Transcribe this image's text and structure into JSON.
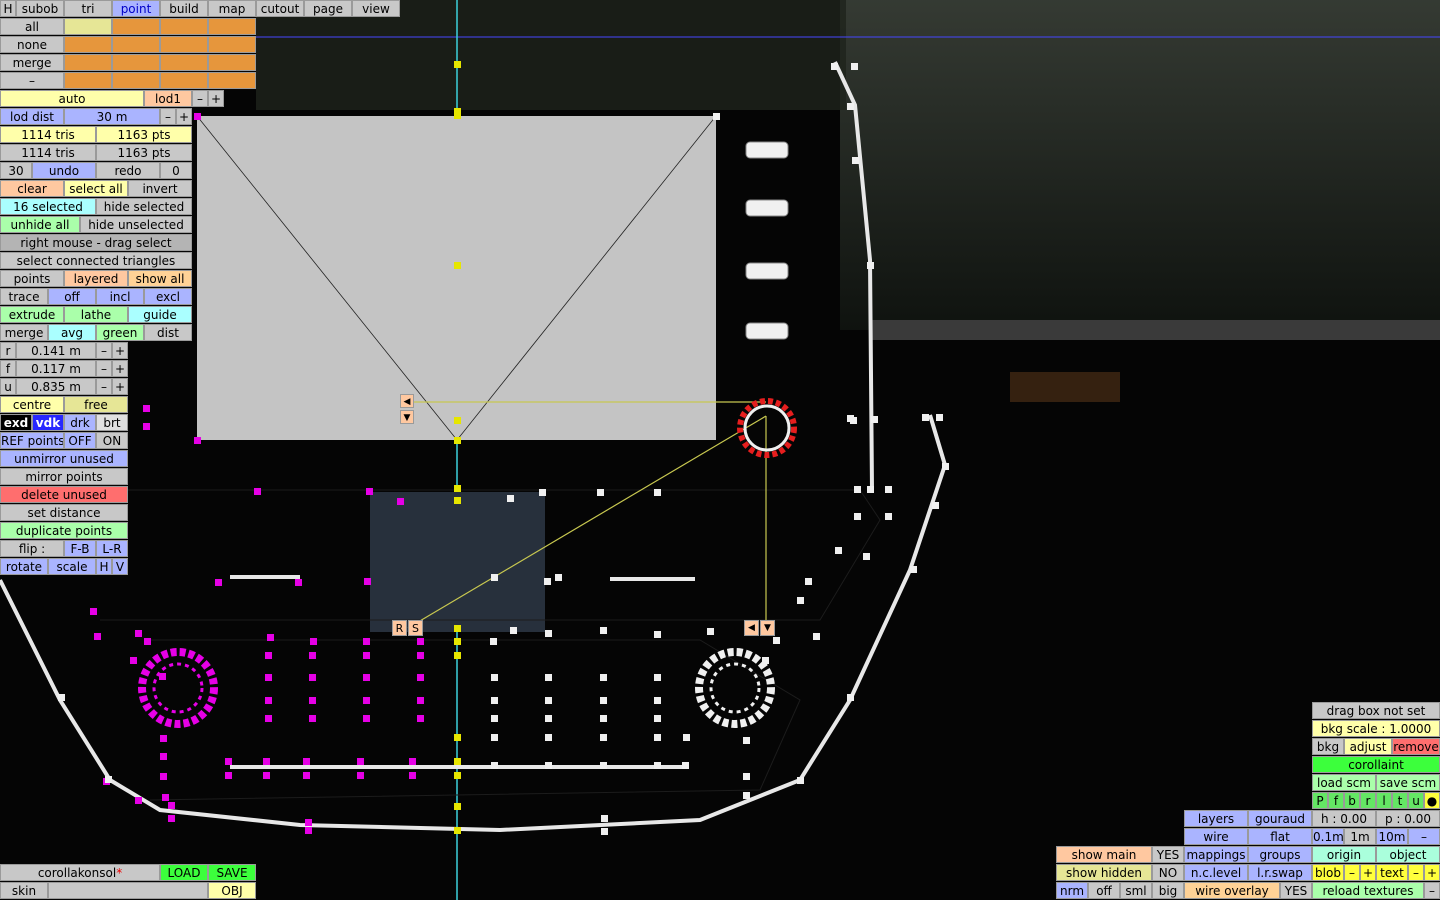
{
  "menu": [
    "H",
    "subob",
    "tri",
    "point",
    "build",
    "map",
    "cutout",
    "page",
    "view"
  ],
  "active_menu": "point",
  "sel_rows": [
    "all",
    "none",
    "merge",
    "–"
  ],
  "lod": {
    "mode": "auto",
    "level": "lod1",
    "minus": "–",
    "plus": "+",
    "dist_label": "lod dist",
    "dist_value": "30 m"
  },
  "stats": {
    "tris1": "1114 tris",
    "pts1": "1163 pts",
    "tris2": "1114 tris",
    "pts2": "1163 pts"
  },
  "history": {
    "count": "30",
    "undo": "undo",
    "redo": "redo",
    "redo_count": "0"
  },
  "select": {
    "clear": "clear",
    "select_all": "select all",
    "invert": "invert",
    "selected": "16 selected",
    "hide_selected": "hide selected",
    "unhide_all": "unhide all",
    "hide_unselected": "hide unselected",
    "drag_hint": "right mouse - drag select",
    "connected": "select connected triangles"
  },
  "mode": {
    "points": "points",
    "layered": "layered",
    "show_all": "show all",
    "trace": "trace",
    "off": "off",
    "incl": "incl",
    "excl": "excl",
    "extrude": "extrude",
    "lathe": "lathe",
    "guide": "guide",
    "merge": "merge",
    "avg": "avg",
    "green": "green",
    "dist": "dist"
  },
  "coords": [
    {
      "axis": "r",
      "value": "0.141 m"
    },
    {
      "axis": "f",
      "value": "0.117 m"
    },
    {
      "axis": "u",
      "value": "0.835 m"
    }
  ],
  "pivot": {
    "centre": "centre",
    "free": "free"
  },
  "view_mode": {
    "exd": "exd",
    "vdk": "vdk",
    "drk": "drk",
    "brt": "brt",
    "ref": "REF points",
    "off": "OFF",
    "on": "ON"
  },
  "actions": {
    "unmirror": "unmirror unused",
    "mirror": "mirror points",
    "delete": "delete unused",
    "set_distance": "set distance",
    "duplicate": "duplicate points",
    "flip": "flip :",
    "fb": "F-B",
    "lr": "L-R",
    "rotate": "rotate",
    "scale": "scale",
    "h": "H",
    "v": "V"
  },
  "file": {
    "name": "corollakonsol",
    "modified_mark": "*",
    "load": "LOAD",
    "save": "SAVE",
    "skin": "skin",
    "obj": "OBJ"
  },
  "markers": {
    "left_arrow": "◀",
    "down_arrow": "▼",
    "r": "R",
    "s": "S"
  },
  "right_panel": {
    "drag_box": "drag box not set",
    "bkg_scale": "bkg scale : 1.0000",
    "bkg": "bkg",
    "adjust": "adjust",
    "remove": "remove",
    "project": "corollaint",
    "load_scm": "load scm",
    "save_scm": "save scm",
    "letters": [
      "P",
      "f",
      "b",
      "r",
      "l",
      "t",
      "u",
      "●"
    ],
    "h": "h : 0.00",
    "p": "p : 0.00",
    "zoom": [
      "0.1m",
      "1m",
      "10m",
      "–"
    ],
    "origin": "origin",
    "object": "object",
    "blob": "blob",
    "minus": "–",
    "plus": "+",
    "text": "text",
    "reload": "reload textures"
  },
  "render_panel": {
    "layers": "layers",
    "gouraud": "gouraud",
    "wire": "wire",
    "flat": "flat",
    "mappings": "mappings",
    "groups": "groups",
    "nclevel": "n.c.level",
    "lrswap": "l.r.swap",
    "wire_overlay": "wire overlay",
    "yes": "YES"
  },
  "show_panel": {
    "show_main": "show main",
    "yes": "YES",
    "show_hidden": "show hidden",
    "no": "NO",
    "nrm": "nrm",
    "off": "off",
    "sml": "sml",
    "big": "big"
  }
}
